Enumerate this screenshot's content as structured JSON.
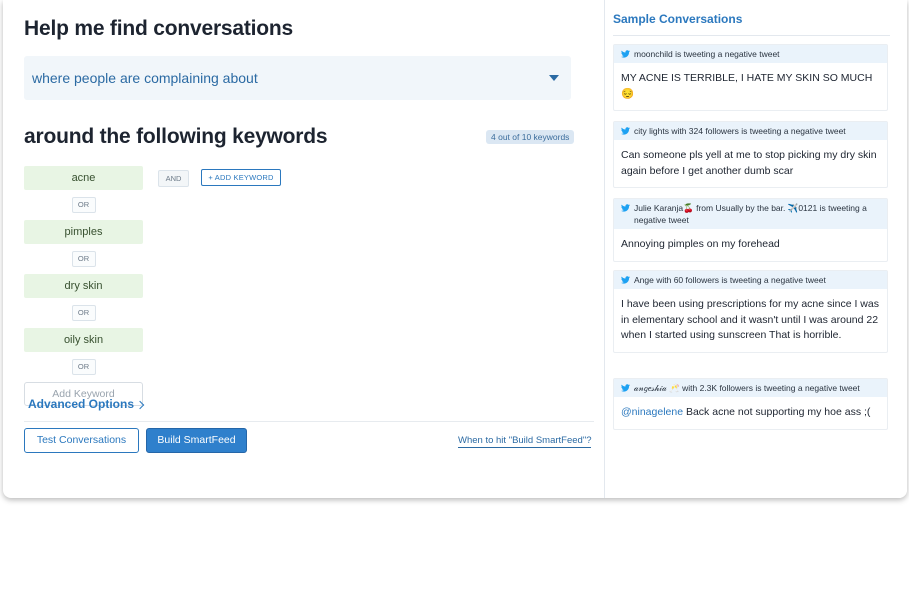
{
  "main": {
    "title": "Help me find conversations",
    "filter_value": "where people are complaining about",
    "keywords_title": "around the following keywords",
    "keyword_count": "4 out of 10 keywords",
    "keywords": [
      "acne",
      "pimples",
      "dry skin",
      "oily skin"
    ],
    "or_label": "OR",
    "add_keyword_placeholder": "Add Keyword",
    "and_label": "AND",
    "add_keyword_button": "+ ADD KEYWORD",
    "advanced_options": "Advanced Options",
    "test_button": "Test Conversations",
    "build_button": "Build SmartFeed",
    "help_link": "When to hit \"Build SmartFeed\"?"
  },
  "sidebar": {
    "title": "Sample Conversations",
    "tweets": [
      {
        "header": "moonchild is tweeting a negative tweet",
        "mention": "",
        "body": "MY ACNE IS TERRIBLE, I HATE MY SKIN SO MUCH 😔"
      },
      {
        "header": "city lights with 324 followers is tweeting a negative tweet",
        "mention": "",
        "body": "Can someone pls yell at me to stop picking my dry skin again before I get another dumb scar"
      },
      {
        "header": "Julie Karanja🍒 from Usually by the bar. ✈️0121 is tweeting a negative tweet",
        "mention": "",
        "body": "Annoying pimples on my forehead"
      },
      {
        "header": "Ange with 60 followers is tweeting a negative tweet",
        "mention": "",
        "body": "I have been using prescriptions for my acne since I was in elementary school and it wasn't until I was around 22 when I started using sunscreen That is horrible."
      },
      {
        "header": "𝒶𝓃𝑔𝑒𝓈𝒽𝒾𝒶 🥂 with 2.3K followers is tweeting a negative tweet",
        "mention": "@ninagelene",
        "body": " Back acne not supporting my hoe ass ;("
      }
    ]
  },
  "colors": {
    "accent": "#2b78be",
    "keyword_bg": "#e8f5e4",
    "tweet_header_bg": "#eaf3fb"
  },
  "icons": {
    "tweet_icon": "twitter-bird-icon",
    "dropdown_icon": "caret-down-icon",
    "advanced_icon": "chevron-right-icon"
  }
}
